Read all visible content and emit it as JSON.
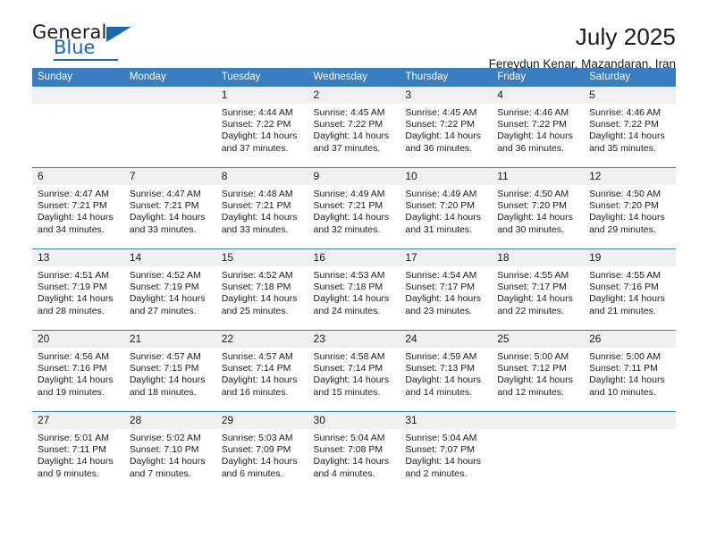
{
  "brand": {
    "name_part1": "General",
    "name_part2": "Blue"
  },
  "header": {
    "title": "July 2025",
    "subtitle": "Fereydun Kenar, Mazandaran, Iran"
  },
  "colors": {
    "header_blue": "#3a7dc0",
    "daynum_band": "#f0f0f0",
    "brand_blue": "#1565b0",
    "text": "#1b1b1b"
  },
  "weekday_headers": [
    "Sunday",
    "Monday",
    "Tuesday",
    "Wednesday",
    "Thursday",
    "Friday",
    "Saturday"
  ],
  "labels": {
    "sunrise_prefix": "Sunrise:",
    "sunset_prefix": "Sunset:",
    "daylight_prefix": "Daylight:"
  },
  "weeks": [
    [
      {
        "day": "",
        "sunrise": "",
        "sunset": "",
        "daylight_line1": "",
        "daylight_line2": ""
      },
      {
        "day": "",
        "sunrise": "",
        "sunset": "",
        "daylight_line1": "",
        "daylight_line2": ""
      },
      {
        "day": "1",
        "sunrise": "Sunrise: 4:44 AM",
        "sunset": "Sunset: 7:22 PM",
        "daylight_line1": "Daylight: 14 hours",
        "daylight_line2": "and 37 minutes."
      },
      {
        "day": "2",
        "sunrise": "Sunrise: 4:45 AM",
        "sunset": "Sunset: 7:22 PM",
        "daylight_line1": "Daylight: 14 hours",
        "daylight_line2": "and 37 minutes."
      },
      {
        "day": "3",
        "sunrise": "Sunrise: 4:45 AM",
        "sunset": "Sunset: 7:22 PM",
        "daylight_line1": "Daylight: 14 hours",
        "daylight_line2": "and 36 minutes."
      },
      {
        "day": "4",
        "sunrise": "Sunrise: 4:46 AM",
        "sunset": "Sunset: 7:22 PM",
        "daylight_line1": "Daylight: 14 hours",
        "daylight_line2": "and 36 minutes."
      },
      {
        "day": "5",
        "sunrise": "Sunrise: 4:46 AM",
        "sunset": "Sunset: 7:22 PM",
        "daylight_line1": "Daylight: 14 hours",
        "daylight_line2": "and 35 minutes."
      }
    ],
    [
      {
        "day": "6",
        "sunrise": "Sunrise: 4:47 AM",
        "sunset": "Sunset: 7:21 PM",
        "daylight_line1": "Daylight: 14 hours",
        "daylight_line2": "and 34 minutes."
      },
      {
        "day": "7",
        "sunrise": "Sunrise: 4:47 AM",
        "sunset": "Sunset: 7:21 PM",
        "daylight_line1": "Daylight: 14 hours",
        "daylight_line2": "and 33 minutes."
      },
      {
        "day": "8",
        "sunrise": "Sunrise: 4:48 AM",
        "sunset": "Sunset: 7:21 PM",
        "daylight_line1": "Daylight: 14 hours",
        "daylight_line2": "and 33 minutes."
      },
      {
        "day": "9",
        "sunrise": "Sunrise: 4:49 AM",
        "sunset": "Sunset: 7:21 PM",
        "daylight_line1": "Daylight: 14 hours",
        "daylight_line2": "and 32 minutes."
      },
      {
        "day": "10",
        "sunrise": "Sunrise: 4:49 AM",
        "sunset": "Sunset: 7:20 PM",
        "daylight_line1": "Daylight: 14 hours",
        "daylight_line2": "and 31 minutes."
      },
      {
        "day": "11",
        "sunrise": "Sunrise: 4:50 AM",
        "sunset": "Sunset: 7:20 PM",
        "daylight_line1": "Daylight: 14 hours",
        "daylight_line2": "and 30 minutes."
      },
      {
        "day": "12",
        "sunrise": "Sunrise: 4:50 AM",
        "sunset": "Sunset: 7:20 PM",
        "daylight_line1": "Daylight: 14 hours",
        "daylight_line2": "and 29 minutes."
      }
    ],
    [
      {
        "day": "13",
        "sunrise": "Sunrise: 4:51 AM",
        "sunset": "Sunset: 7:19 PM",
        "daylight_line1": "Daylight: 14 hours",
        "daylight_line2": "and 28 minutes."
      },
      {
        "day": "14",
        "sunrise": "Sunrise: 4:52 AM",
        "sunset": "Sunset: 7:19 PM",
        "daylight_line1": "Daylight: 14 hours",
        "daylight_line2": "and 27 minutes."
      },
      {
        "day": "15",
        "sunrise": "Sunrise: 4:52 AM",
        "sunset": "Sunset: 7:18 PM",
        "daylight_line1": "Daylight: 14 hours",
        "daylight_line2": "and 25 minutes."
      },
      {
        "day": "16",
        "sunrise": "Sunrise: 4:53 AM",
        "sunset": "Sunset: 7:18 PM",
        "daylight_line1": "Daylight: 14 hours",
        "daylight_line2": "and 24 minutes."
      },
      {
        "day": "17",
        "sunrise": "Sunrise: 4:54 AM",
        "sunset": "Sunset: 7:17 PM",
        "daylight_line1": "Daylight: 14 hours",
        "daylight_line2": "and 23 minutes."
      },
      {
        "day": "18",
        "sunrise": "Sunrise: 4:55 AM",
        "sunset": "Sunset: 7:17 PM",
        "daylight_line1": "Daylight: 14 hours",
        "daylight_line2": "and 22 minutes."
      },
      {
        "day": "19",
        "sunrise": "Sunrise: 4:55 AM",
        "sunset": "Sunset: 7:16 PM",
        "daylight_line1": "Daylight: 14 hours",
        "daylight_line2": "and 21 minutes."
      }
    ],
    [
      {
        "day": "20",
        "sunrise": "Sunrise: 4:56 AM",
        "sunset": "Sunset: 7:16 PM",
        "daylight_line1": "Daylight: 14 hours",
        "daylight_line2": "and 19 minutes."
      },
      {
        "day": "21",
        "sunrise": "Sunrise: 4:57 AM",
        "sunset": "Sunset: 7:15 PM",
        "daylight_line1": "Daylight: 14 hours",
        "daylight_line2": "and 18 minutes."
      },
      {
        "day": "22",
        "sunrise": "Sunrise: 4:57 AM",
        "sunset": "Sunset: 7:14 PM",
        "daylight_line1": "Daylight: 14 hours",
        "daylight_line2": "and 16 minutes."
      },
      {
        "day": "23",
        "sunrise": "Sunrise: 4:58 AM",
        "sunset": "Sunset: 7:14 PM",
        "daylight_line1": "Daylight: 14 hours",
        "daylight_line2": "and 15 minutes."
      },
      {
        "day": "24",
        "sunrise": "Sunrise: 4:59 AM",
        "sunset": "Sunset: 7:13 PM",
        "daylight_line1": "Daylight: 14 hours",
        "daylight_line2": "and 14 minutes."
      },
      {
        "day": "25",
        "sunrise": "Sunrise: 5:00 AM",
        "sunset": "Sunset: 7:12 PM",
        "daylight_line1": "Daylight: 14 hours",
        "daylight_line2": "and 12 minutes."
      },
      {
        "day": "26",
        "sunrise": "Sunrise: 5:00 AM",
        "sunset": "Sunset: 7:11 PM",
        "daylight_line1": "Daylight: 14 hours",
        "daylight_line2": "and 10 minutes."
      }
    ],
    [
      {
        "day": "27",
        "sunrise": "Sunrise: 5:01 AM",
        "sunset": "Sunset: 7:11 PM",
        "daylight_line1": "Daylight: 14 hours",
        "daylight_line2": "and 9 minutes."
      },
      {
        "day": "28",
        "sunrise": "Sunrise: 5:02 AM",
        "sunset": "Sunset: 7:10 PM",
        "daylight_line1": "Daylight: 14 hours",
        "daylight_line2": "and 7 minutes."
      },
      {
        "day": "29",
        "sunrise": "Sunrise: 5:03 AM",
        "sunset": "Sunset: 7:09 PM",
        "daylight_line1": "Daylight: 14 hours",
        "daylight_line2": "and 6 minutes."
      },
      {
        "day": "30",
        "sunrise": "Sunrise: 5:04 AM",
        "sunset": "Sunset: 7:08 PM",
        "daylight_line1": "Daylight: 14 hours",
        "daylight_line2": "and 4 minutes."
      },
      {
        "day": "31",
        "sunrise": "Sunrise: 5:04 AM",
        "sunset": "Sunset: 7:07 PM",
        "daylight_line1": "Daylight: 14 hours",
        "daylight_line2": "and 2 minutes."
      },
      {
        "day": "",
        "sunrise": "",
        "sunset": "",
        "daylight_line1": "",
        "daylight_line2": ""
      },
      {
        "day": "",
        "sunrise": "",
        "sunset": "",
        "daylight_line1": "",
        "daylight_line2": ""
      }
    ]
  ]
}
